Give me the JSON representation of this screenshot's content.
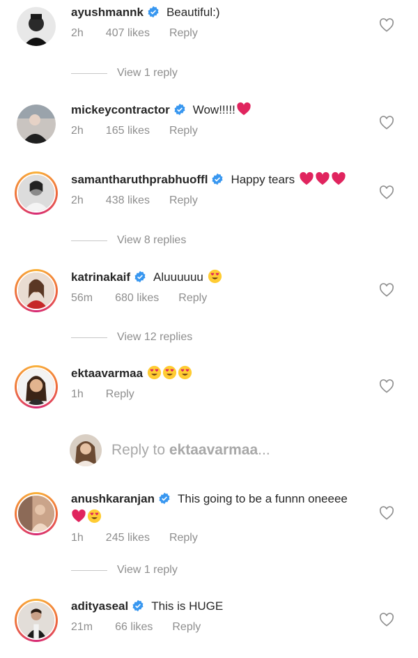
{
  "comments": [
    {
      "username": "ayushmannk",
      "verified": true,
      "text": "Beautiful:)",
      "time": "2h",
      "likes": "407 likes",
      "reply": "Reply"
    },
    {
      "username": "mickeycontractor",
      "verified": true,
      "text": "Wow!!!!!",
      "time": "2h",
      "likes": "165 likes",
      "reply": "Reply"
    },
    {
      "username": "samantharuthprabhuoffl",
      "verified": true,
      "text": "Happy tears",
      "time": "2h",
      "likes": "438 likes",
      "reply": "Reply"
    },
    {
      "username": "katrinakaif",
      "verified": true,
      "text": "Aluuuuuu",
      "time": "56m",
      "likes": "680 likes",
      "reply": "Reply"
    },
    {
      "username": "ektaavarmaa",
      "verified": false,
      "text": "",
      "time": "1h",
      "likes": "",
      "reply": "Reply"
    },
    {
      "username": "anushkaranjan",
      "verified": true,
      "text": "This going to be a funnn oneeee",
      "time": "1h",
      "likes": "245 likes",
      "reply": "Reply"
    },
    {
      "username": "adityaseal",
      "verified": true,
      "text": "This is HUGE",
      "time": "21m",
      "likes": "66 likes",
      "reply": "Reply"
    }
  ],
  "view_replies": [
    "View 1 reply",
    "View 8 replies",
    "View 12 replies",
    "View 1 reply"
  ],
  "reply_box": {
    "prefix": "Reply to ",
    "target": "ektaavarmaa",
    "suffix": "..."
  },
  "icons": {
    "verified": "verified-badge-icon",
    "like": "heart-outline-icon",
    "emoji_heart": "red-heart",
    "emoji_heart_eyes": "heart-eyes-face"
  },
  "colors": {
    "verified": "#3897f0",
    "secondary_text": "#8e8e8e",
    "heart": "#e0245e"
  }
}
